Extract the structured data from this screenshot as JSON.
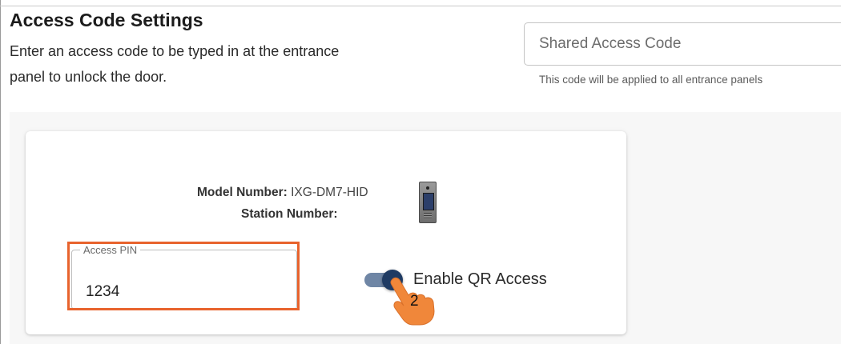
{
  "page": {
    "title": "Access Code Settings",
    "description": "Enter an access code to be typed in at the entrance panel to unlock the door."
  },
  "shared_code": {
    "placeholder": "Shared Access Code",
    "value": "",
    "helper": "This code will be applied to all entrance panels"
  },
  "station": {
    "model_label": "Model Number:",
    "model_value": "IXG-DM7-HID",
    "station_label": "Station Number:",
    "station_value": "",
    "device_icon": "entrance-panel-device-icon",
    "pin_label": "Access PIN",
    "pin_value": "1234",
    "qr_label": "Enable QR Access",
    "qr_enabled": true
  },
  "annotation": {
    "step_number": "2",
    "highlight_color": "#e8632d",
    "pointer_color": "#f0873a",
    "icon": "hand-pointer-icon"
  },
  "colors": {
    "toggle_thumb": "#1f3b63",
    "toggle_track": "#6f86a5"
  }
}
